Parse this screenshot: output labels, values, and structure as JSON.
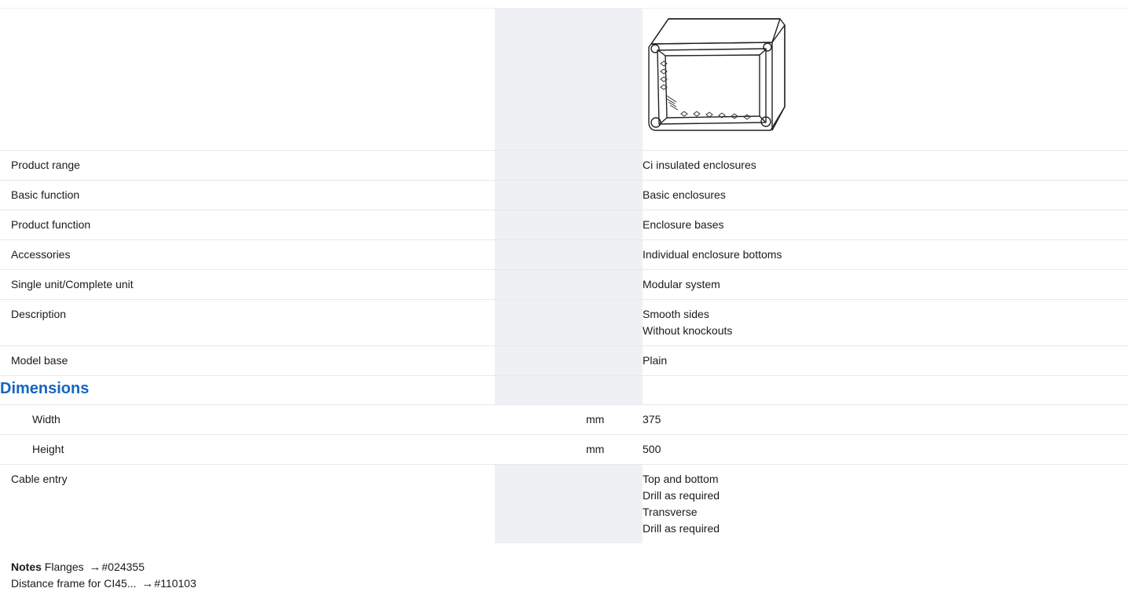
{
  "rows": [
    {
      "label": "Product range",
      "values": [
        "Ci insulated enclosures"
      ]
    },
    {
      "label": "Basic function",
      "values": [
        "Basic enclosures"
      ]
    },
    {
      "label": "Product function",
      "values": [
        "Enclosure bases"
      ]
    },
    {
      "label": "Accessories",
      "values": [
        "Individual enclosure bottoms"
      ]
    },
    {
      "label": "Single unit/Complete unit",
      "values": [
        "Modular system"
      ]
    },
    {
      "label": "Description",
      "values": [
        "Smooth sides",
        "Without knockouts"
      ]
    },
    {
      "label": "Model base",
      "values": [
        "Plain"
      ]
    }
  ],
  "dimensions": {
    "title": "Dimensions",
    "width": {
      "label": "Width",
      "unit": "mm",
      "value": "375"
    },
    "height": {
      "label": "Height",
      "unit": "mm",
      "value": "500"
    }
  },
  "cable_entry": {
    "label": "Cable entry",
    "values": [
      "Top and bottom",
      "Drill as required",
      "Transverse",
      "Drill as required"
    ]
  },
  "notes": {
    "heading": "Notes",
    "line1_text": "Flanges",
    "line1_ref": "#024355",
    "line2_text": "Distance frame for CI45...",
    "line2_ref": "#110103",
    "arrow": "→"
  }
}
